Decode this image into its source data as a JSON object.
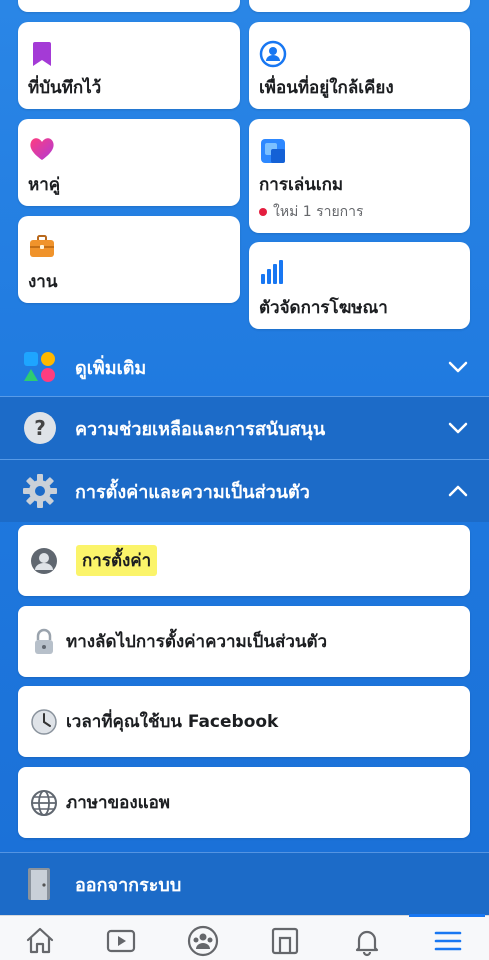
{
  "shortcuts": {
    "saved": {
      "label": "ที่บันทึกไว้",
      "icon": "bookmark-icon"
    },
    "nearby_friends": {
      "label": "เพื่อนที่อยู่ใกล้เคียง",
      "icon": "nearby-friends-icon"
    },
    "dating": {
      "label": "หาคู่",
      "icon": "heart-icon"
    },
    "gaming": {
      "label": "การเล่นเกม",
      "badge": "ใหม่ 1 รายการ",
      "icon": "gaming-icon"
    },
    "jobs": {
      "label": "งาน",
      "icon": "briefcase-icon"
    },
    "ads_manager": {
      "label": "ตัวจัดการโฆษณา",
      "icon": "ads-chart-icon"
    }
  },
  "sections": {
    "see_more": {
      "label": "ดูเพิ่มเติม",
      "icon": "shapes-icon"
    },
    "help": {
      "label": "ความช่วยเหลือและการสนับสนุน",
      "icon": "question-icon"
    },
    "settings_privacy": {
      "label": "การตั้งค่าและความเป็นส่วนตัว",
      "icon": "gear-icon"
    },
    "logout": {
      "label": "ออกจากระบบ",
      "icon": "door-icon"
    }
  },
  "settings_items": [
    {
      "label": "การตั้งค่า",
      "icon": "user-circle-icon",
      "highlighted": true
    },
    {
      "label": "ทางลัดไปการตั้งค่าความเป็นส่วนตัว",
      "icon": "lock-icon"
    },
    {
      "label": "เวลาที่คุณใช้บน Facebook",
      "icon": "clock-icon"
    },
    {
      "label": "ภาษาของแอพ",
      "icon": "globe-icon"
    }
  ],
  "tabbar": {
    "tabs": [
      "home-icon",
      "watch-icon",
      "groups-icon",
      "marketplace-icon",
      "notifications-icon",
      "menu-icon"
    ],
    "active": "menu-icon"
  },
  "colors": {
    "brand_blue": "#1877f2",
    "badge_red": "#e41e3f",
    "highlight": "#fbf46a"
  }
}
